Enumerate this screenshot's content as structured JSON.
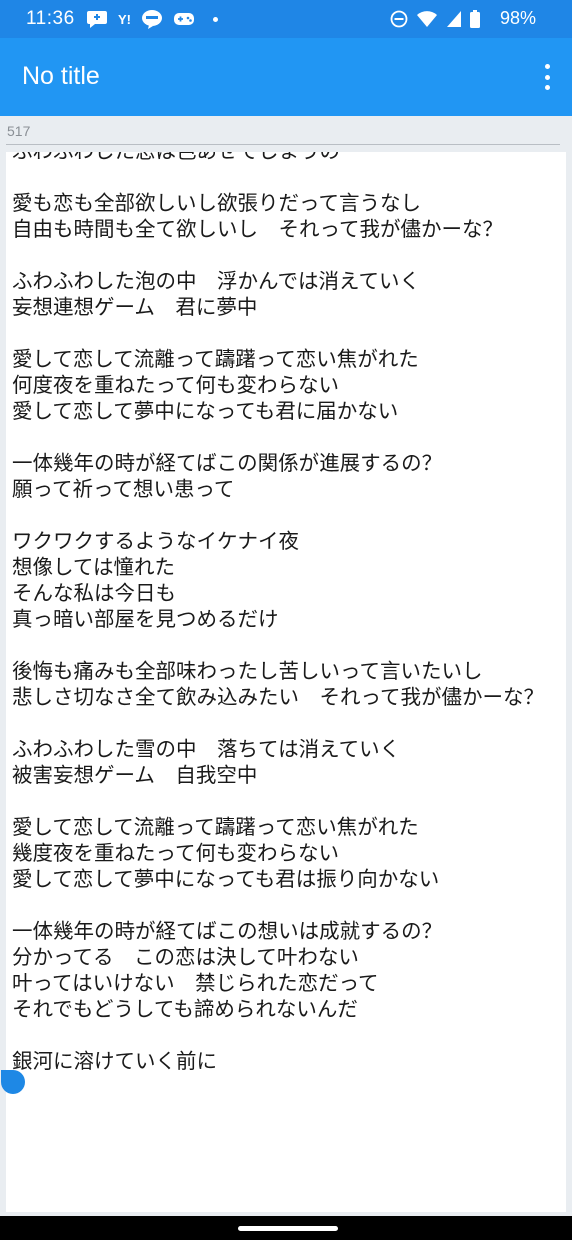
{
  "status_bar": {
    "time": "11:36",
    "yahoo_label": "Y!",
    "battery_percent": "98%",
    "icons": [
      "chat-icon",
      "yahoo-icon",
      "line-icon",
      "game-icon",
      "dot-icon",
      "dnd-icon",
      "wifi-icon",
      "signal-icon",
      "battery-icon"
    ]
  },
  "app_bar": {
    "title": "No title",
    "menu_icon": "more-vert-icon"
  },
  "editor": {
    "char_count": "517",
    "content": "ふわふわした恋は色あせてしまうの\n\n愛も恋も全部欲しいし欲張りだって言うなし\n自由も時間も全て欲しいし　それって我が儘かーな？\n\nふわふわした泡の中　浮かんでは消えていく\n妄想連想ゲーム　君に夢中\n\n愛して恋して流離って躊躇って恋い焦がれた\n何度夜を重ねたって何も変わらない\n愛して恋して夢中になっても君に届かない\n\n一体幾年の時が経てばこの関係が進展するの？\n願って祈って想い患って\n\nワクワクするようなイケナイ夜\n想像しては憧れた\nそんな私は今日も\n真っ暗い部屋を見つめるだけ\n\n後悔も痛みも全部味わったし苦しいって言いたいし\n悲しさ切なさ全て飲み込みたい　それって我が儘かーな？\n\nふわふわした雪の中　落ちては消えていく\n被害妄想ゲーム　自我空中\n\n愛して恋して流離って躊躇って恋い焦がれた\n幾度夜を重ねたって何も変わらない\n愛して恋して夢中になっても君は振り向かない\n\n一体幾年の時が経てばこの想いは成就するの？\n分かってる　この恋は決して叶わない\n叶ってはいけない　禁じられた恋だって\nそれでもどうしても諦められないんだ\n\n銀河に溶けていく前に"
  },
  "colors": {
    "status_bar": "#1f86e6",
    "app_bar": "#2196f3",
    "accent": "#1e88e5",
    "background": "#e9edf1"
  }
}
